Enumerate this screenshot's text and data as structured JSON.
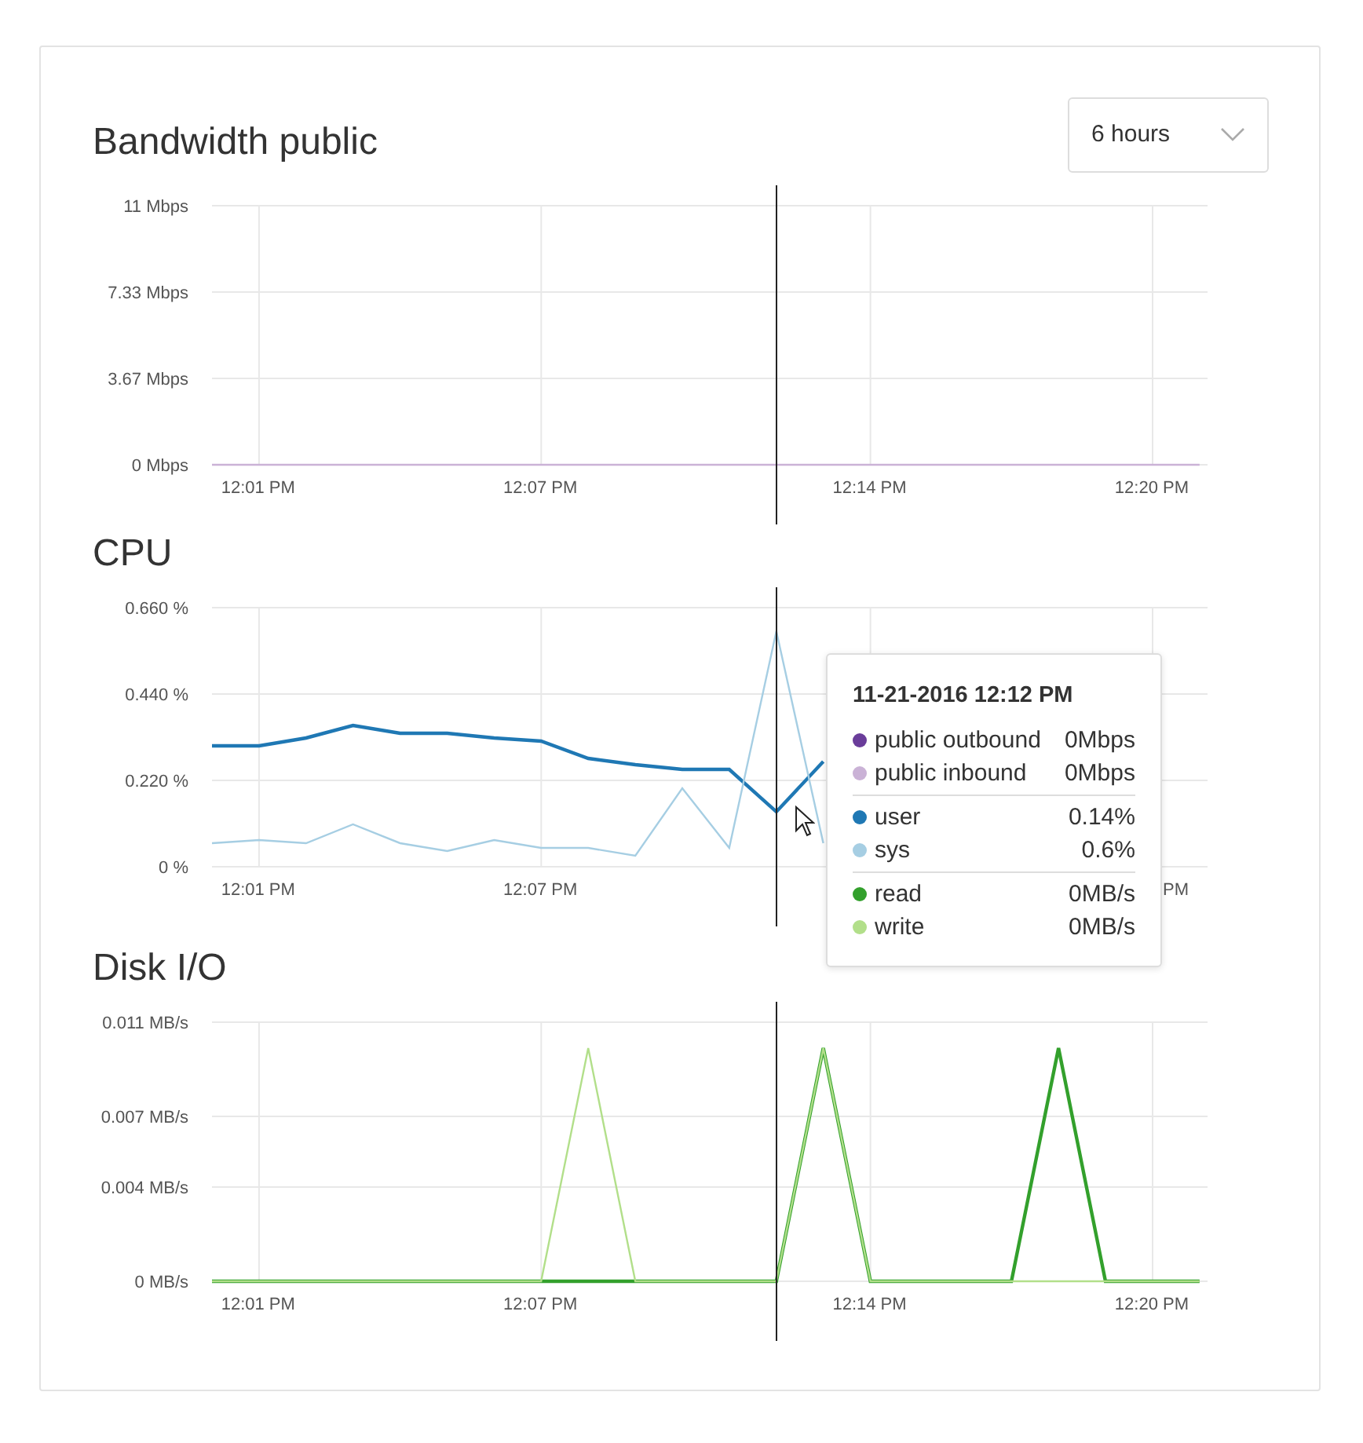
{
  "range_select": {
    "value": "6 hours"
  },
  "charts": [
    {
      "title": "Bandwidth public",
      "chart_data": {
        "type": "line",
        "grid": true,
        "categories": [
          null,
          "12:01 PM",
          null,
          null,
          null,
          null,
          null,
          "12:07 PM",
          null,
          null,
          null,
          null,
          null,
          null,
          "12:14 PM",
          null,
          null,
          null,
          null,
          null,
          "12:20 PM",
          null
        ],
        "ylim": [
          0,
          11
        ],
        "yticks": [
          {
            "value": 0,
            "label": "0 Mbps"
          },
          {
            "value": 3.67,
            "label": "3.67 Mbps"
          },
          {
            "value": 7.33,
            "label": "7.33 Mbps"
          },
          {
            "value": 11,
            "label": "11 Mbps"
          }
        ],
        "series": [
          {
            "name": "public outbound",
            "color": "#6a3d9a",
            "values": [
              null,
              null,
              null,
              null,
              null,
              null,
              null,
              null,
              null,
              null,
              null,
              null,
              null,
              null,
              null,
              null,
              null,
              null,
              null,
              null,
              null,
              null
            ]
          },
          {
            "name": "public inbound",
            "color": "#cab2d6",
            "values": [
              0,
              0,
              0,
              0,
              0,
              0,
              0,
              0,
              0,
              0,
              0,
              0,
              0,
              0,
              0,
              0,
              0,
              0,
              0,
              0,
              0,
              0
            ]
          }
        ]
      }
    },
    {
      "title": "CPU",
      "chart_data": {
        "type": "line",
        "grid": true,
        "categories": [
          null,
          "12:01 PM",
          null,
          null,
          null,
          null,
          null,
          "12:07 PM",
          null,
          null,
          null,
          null,
          null,
          null,
          null,
          null,
          null,
          null,
          null,
          null,
          "PM",
          null
        ],
        "ylim": [
          0,
          0.66
        ],
        "yticks": [
          {
            "value": 0,
            "label": "0 %"
          },
          {
            "value": 0.22,
            "label": "0.220 %"
          },
          {
            "value": 0.44,
            "label": "0.440 %"
          },
          {
            "value": 0.66,
            "label": "0.660 %"
          }
        ],
        "series": [
          {
            "name": "user",
            "color": "#1f78b4",
            "values": [
              0.308,
              0.308,
              0.328,
              0.36,
              0.34,
              0.34,
              0.328,
              0.32,
              0.276,
              0.26,
              0.248,
              0.248,
              0.14,
              0.268,
              null,
              null,
              null,
              null,
              null,
              null,
              null,
              null
            ]
          },
          {
            "name": "sys",
            "color": "#a6cee3",
            "values": [
              0.06,
              0.068,
              0.06,
              0.108,
              0.06,
              0.04,
              0.068,
              0.048,
              0.048,
              0.028,
              0.2,
              0.048,
              0.6,
              0.06,
              null,
              null,
              null,
              null,
              null,
              null,
              null,
              null
            ]
          }
        ]
      }
    },
    {
      "title": "Disk I/O",
      "chart_data": {
        "type": "line",
        "grid": true,
        "categories": [
          null,
          "12:01 PM",
          null,
          null,
          null,
          null,
          null,
          "12:07 PM",
          null,
          null,
          null,
          null,
          null,
          null,
          "12:14 PM",
          null,
          null,
          null,
          null,
          null,
          "12:20 PM",
          null
        ],
        "ylim": [
          0,
          0.011
        ],
        "yticks": [
          {
            "value": 0,
            "label": "0 MB/s"
          },
          {
            "value": 0.004,
            "label": "0.004 MB/s"
          },
          {
            "value": 0.007,
            "label": "0.007 MB/s"
          },
          {
            "value": 0.011,
            "label": "0.011 MB/s"
          }
        ],
        "series": [
          {
            "name": "read",
            "color": "#33a02c",
            "values": [
              0,
              0,
              0,
              0,
              0,
              0,
              0,
              0,
              0,
              0,
              0,
              0,
              0,
              0.0099,
              0,
              0,
              0,
              0,
              0.0099,
              0,
              0,
              0
            ]
          },
          {
            "name": "write",
            "color": "#b2df8a",
            "values": [
              0,
              0,
              0,
              0,
              0,
              0,
              0,
              0,
              0.0099,
              0,
              0,
              0,
              0,
              0.0099,
              0,
              0,
              0,
              0,
              0,
              0,
              0,
              0
            ]
          }
        ]
      }
    }
  ],
  "tooltip": {
    "title": "11-21-2016 12:12 PM",
    "values": [
      [
        "0Mbps",
        "0Mbps"
      ],
      [
        "0.14%",
        "0.6%"
      ],
      [
        "0MB/s",
        "0MB/s"
      ]
    ]
  }
}
